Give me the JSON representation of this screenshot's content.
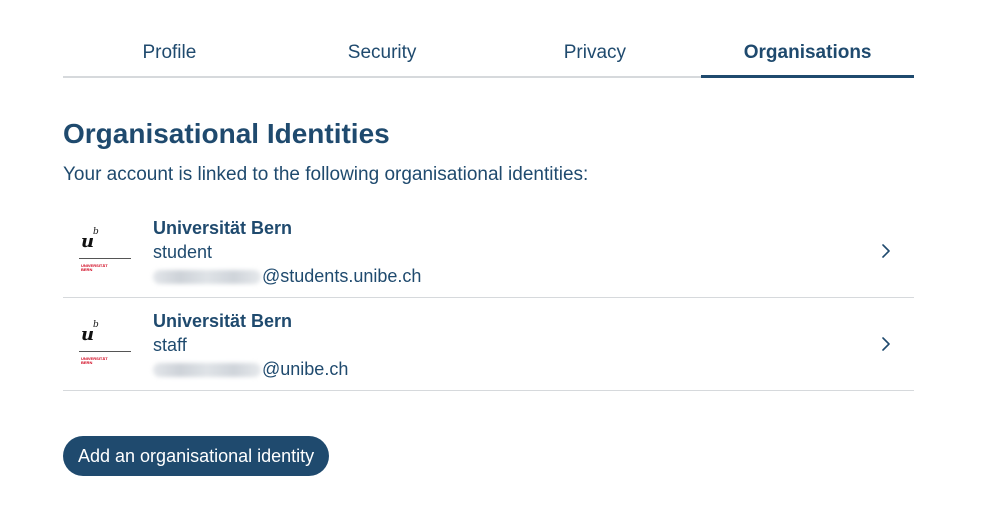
{
  "tabs": [
    {
      "label": "Profile",
      "active": false
    },
    {
      "label": "Security",
      "active": false
    },
    {
      "label": "Privacy",
      "active": false
    },
    {
      "label": "Organisations",
      "active": true
    }
  ],
  "section": {
    "title": "Organisational Identities",
    "subtitle": "Your account is linked to the following organisational identities:"
  },
  "identities": [
    {
      "org": "Universität Bern",
      "role": "student",
      "email_domain": "@students.unibe.ch",
      "logo": {
        "letter": "u",
        "superscript": "b",
        "line1": "UNIVERSITÄT",
        "line2": "BERN"
      },
      "icon": "chevron-right-icon"
    },
    {
      "org": "Universität Bern",
      "role": "staff",
      "email_domain": "@unibe.ch",
      "logo": {
        "letter": "u",
        "superscript": "b",
        "line1": "UNIVERSITÄT",
        "line2": "BERN"
      },
      "icon": "chevron-right-icon"
    }
  ],
  "actions": {
    "add_label": "Add an organisational identity"
  },
  "colors": {
    "primary": "#1f4a6e",
    "divider": "#d6d9dc",
    "logo_red": "#d0021b"
  }
}
